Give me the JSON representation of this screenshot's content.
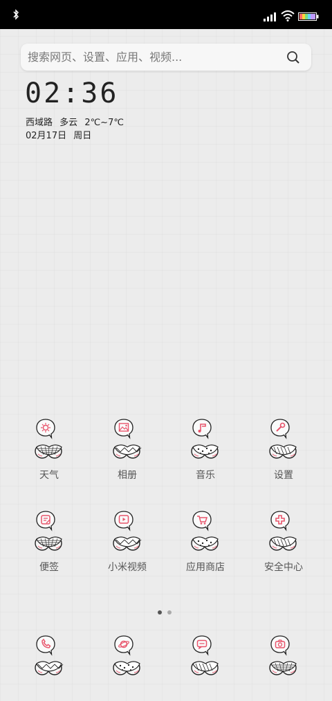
{
  "status_bar": {
    "icons": [
      "bluetooth-icon",
      "signal-icon",
      "wifi-icon",
      "battery-icon"
    ]
  },
  "search": {
    "placeholder": "搜索网页、设置、应用、视频...",
    "icon": "search-icon"
  },
  "clock": {
    "time": "02:36"
  },
  "weather": {
    "location": "西域路",
    "condition": "多云",
    "temp_range": "2℃~7℃"
  },
  "date": {
    "date": "02月17日",
    "weekday": "周日"
  },
  "apps": [
    {
      "label": "天气",
      "icon": "weather-app-icon",
      "glyph": "sun"
    },
    {
      "label": "相册",
      "icon": "gallery-app-icon",
      "glyph": "image"
    },
    {
      "label": "音乐",
      "icon": "music-app-icon",
      "glyph": "note"
    },
    {
      "label": "设置",
      "icon": "settings-app-icon",
      "glyph": "wrench"
    },
    {
      "label": "便签",
      "icon": "notes-app-icon",
      "glyph": "note-edit"
    },
    {
      "label": "小米视频",
      "icon": "video-app-icon",
      "glyph": "play"
    },
    {
      "label": "应用商店",
      "icon": "app-store-icon",
      "glyph": "cart"
    },
    {
      "label": "安全中心",
      "icon": "security-app-icon",
      "glyph": "cross"
    }
  ],
  "dock": [
    {
      "icon": "phone-app-icon",
      "glyph": "phone"
    },
    {
      "icon": "browser-app-icon",
      "glyph": "planet"
    },
    {
      "icon": "messages-app-icon",
      "glyph": "chat"
    },
    {
      "icon": "camera-app-icon",
      "glyph": "camera"
    }
  ],
  "page_indicator": {
    "pages": 2,
    "current": 1
  },
  "colors": {
    "accent": "#e8546b",
    "background": "#ececec",
    "status_bar": "#000000"
  }
}
